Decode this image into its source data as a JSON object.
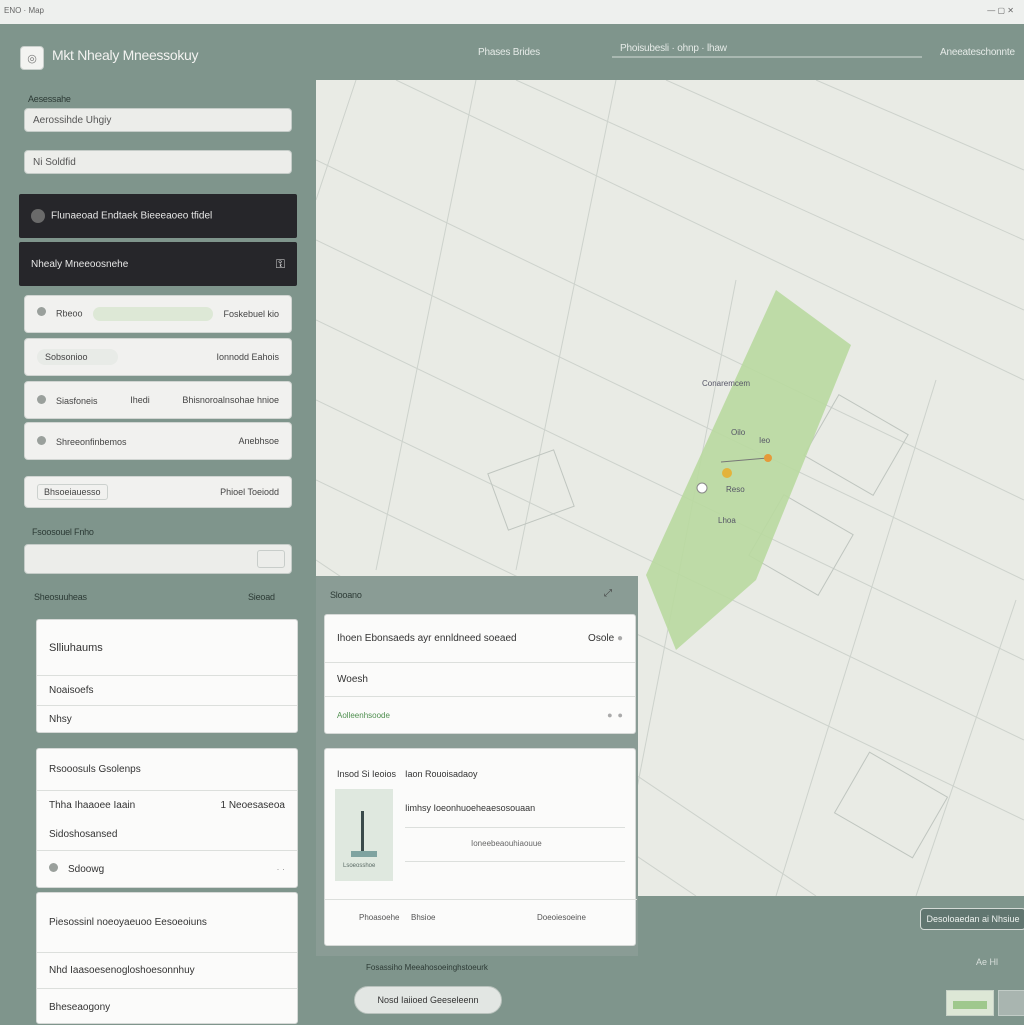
{
  "browser": {
    "tab_text": "ENO  ·  Map",
    "right_text": "— ▢ ✕"
  },
  "header": {
    "logo_glyph": "◎",
    "title": "Mkt Nhealy Mneessokuy",
    "links": [
      "Phases Brides",
      "Phoisubesli · ohnp · lhaw",
      "Aneeateschonnte"
    ]
  },
  "sidebar": {
    "section_label": "Aesessahe",
    "search_value": "Aerossihde Uhgiy",
    "filter_value": "Ni Soldfid",
    "dark_rows": [
      {
        "label": "Flunaeoad Endtaek Bieeeaoeo tfidel",
        "icon": "gear-icon"
      },
      {
        "label": "Nhealy Mneeoosnehe",
        "icon": "lock-icon"
      }
    ],
    "list_rows": [
      {
        "left": "Rbeoo",
        "right": "Foskebuel kio"
      },
      {
        "left": "Sobsonioo",
        "right": "Ionnodd Eahois"
      },
      {
        "left": "Siasfoneis",
        "mid": "Ihedi",
        "right": "Bhisnoroalnsohae hnioe"
      },
      {
        "left": "Shreeonfinbemos",
        "right": "Anebhsoe"
      }
    ],
    "summary": {
      "left": "Bhsoeiauesso",
      "right": "Phioel Toeiodd"
    },
    "input_label": "Fsoosouel Fnho",
    "input_value": ""
  },
  "map": {
    "labels": [
      "Conaremcem",
      "Oilo",
      "Ieo",
      "Reso",
      "Lhoa"
    ],
    "colors": {
      "land": "#e9ebe5",
      "park": "#b9d9a0",
      "lines": "#c9cec9"
    }
  },
  "lower_left": {
    "header_left": "Sheosuuheas",
    "header_right": "Sieoad",
    "card1": {
      "title": "Slliuhaums",
      "rows": [
        "Noaisoefs",
        "Nhsy"
      ]
    },
    "card2": {
      "title": "Rsooosuls Gsolenps",
      "row_left": "Thha Ihaaoee Iaain",
      "row_right": "1  Neoesaseoa",
      "sub": "Sidoshosansed",
      "foot": "Sdoowg"
    },
    "card3": {
      "title": "Piesossinl noeoyaeuoo Eesoeoiuns",
      "row1": "Nhd Iaasoesenogloshoesonnhuy",
      "row2": "Bheseaogony"
    }
  },
  "middle": {
    "header_left": "Slooano",
    "card1": {
      "title": "Ihoen Ebonsaeds ayr ennldneed soeaed",
      "title_right": "Osole",
      "row": "Woesh",
      "footer_link": "Aolleenhsoode"
    },
    "card2": {
      "label_left": "Insod Si Ieoios",
      "label_right": "Iaon Rouoisadaoy",
      "line1": "Iimhsy Ioeonhuoeheaesosouaan",
      "line2": "Ioneebeaouhiaouue",
      "footer": [
        "Phoasoehe",
        "Bhsioe",
        "Doeoiesoeine"
      ],
      "thumb_caption": "Lsoeosshoe"
    }
  },
  "bottom": {
    "caption": "Fosassiho Meeahosoeinghstoeurk",
    "button_label": "Nosd Iaiioed Geeseleenn",
    "right_button": "Desoloaedan ai",
    "right_button2": "Nhsiue",
    "corner_text": "Ae Hl"
  }
}
